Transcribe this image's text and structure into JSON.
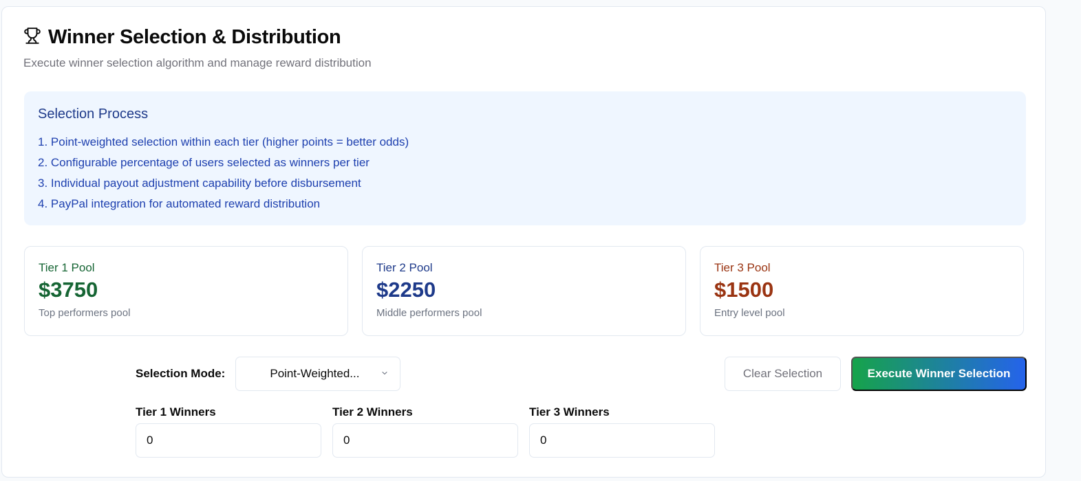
{
  "header": {
    "title": "Winner Selection & Distribution",
    "subtitle": "Execute winner selection algorithm and manage reward distribution",
    "icon": "trophy-icon"
  },
  "process": {
    "title": "Selection Process",
    "steps": [
      "1. Point-weighted selection within each tier (higher points = better odds)",
      "2. Configurable percentage of users selected as winners per tier",
      "3. Individual payout adjustment capability before disbursement",
      "4. PayPal integration for automated reward distribution"
    ]
  },
  "pools": [
    {
      "label": "Tier 1 Pool",
      "amount": "$3750",
      "desc": "Top performers pool",
      "color": "#166534"
    },
    {
      "label": "Tier 2 Pool",
      "amount": "$2250",
      "desc": "Middle performers pool",
      "color": "#1e3a8a"
    },
    {
      "label": "Tier 3 Pool",
      "amount": "$1500",
      "desc": "Entry level pool",
      "color": "#9a3412"
    }
  ],
  "controls": {
    "mode_label": "Selection Mode:",
    "mode_value": "Point-Weighted...",
    "clear_label": "Clear Selection",
    "execute_label": "Execute Winner Selection"
  },
  "winners": [
    {
      "label": "Tier 1 Winners",
      "value": "0"
    },
    {
      "label": "Tier 2 Winners",
      "value": "0"
    },
    {
      "label": "Tier 3 Winners",
      "value": "0"
    }
  ]
}
